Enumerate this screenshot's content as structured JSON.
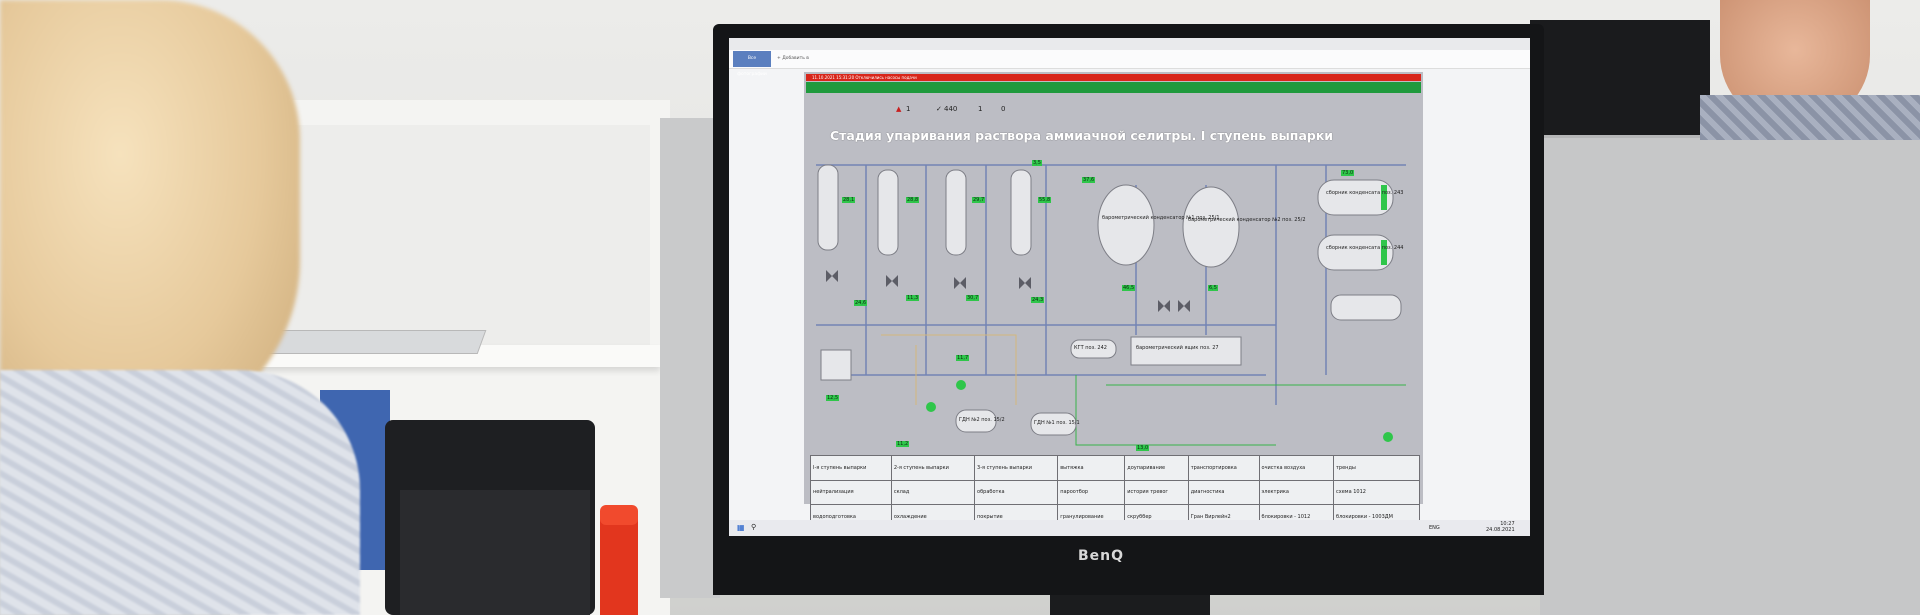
{
  "app": {
    "tab_active": "Все фотографии",
    "tab_add": "+ Добавить в"
  },
  "scada": {
    "alarm_text": "11.10.2021 15:31:20 Отключились насосы подачи",
    "counters": [
      "1",
      "440",
      "1",
      "0"
    ],
    "title": "Стадия упаривания раствора аммиачной селитры. I ступень выпарки",
    "units": {
      "collector_243": "сборник конденсата поз. 243",
      "collector_244": "сборник конденсата поз. 244",
      "baro_cond_1": "барометрический конденсатор №1 поз. 25/1",
      "baro_cond_2": "барометрический конденсатор №2 поз. 25/2",
      "baro_box": "барометрический ящик поз. 27",
      "gdn_2": "ГДН №2 поз. 15/2",
      "gdn_1": "ГДН №1 поз. 15/1",
      "kgt": "КГТ поз. 242"
    },
    "tags": [
      "28,1",
      "28,8",
      "29,7",
      "55,8",
      "3,5",
      "37,6",
      "73,0",
      "11,7",
      "11,3",
      "30,7",
      "24,3",
      "24,6",
      "11,2",
      "12,5",
      "46,5",
      "6,5",
      "13,0"
    ],
    "table": [
      [
        "I-я ступень выпарки",
        "2-я ступень выпарки",
        "3-я ступень выпарки",
        "вытяжка",
        "доупаривание",
        "транспортировка",
        "очистка воздуха",
        "тренды"
      ],
      [
        "нейтрализация",
        "склад",
        "обработка",
        "пароотбор",
        "история тревог",
        "диагностика",
        "электрика",
        "схема 1012"
      ],
      [
        "водоподготовка",
        "охлаждение",
        "покрытие",
        "гранулирование",
        "скруббер",
        "Гран Вирлейн2",
        "блокировки - 1012",
        "блокировки - 1003ДМ"
      ]
    ]
  },
  "taskbar": {
    "lang": "ENG",
    "time": "10:27",
    "date": "24.08.2021"
  },
  "monitor": {
    "brand": "BenQ"
  },
  "colors": {
    "alarm_red": "#d8261b",
    "alarm_green": "#1f9a3d",
    "scada_bg": "#bcbdc4",
    "tag_green": "#2fc64a"
  }
}
